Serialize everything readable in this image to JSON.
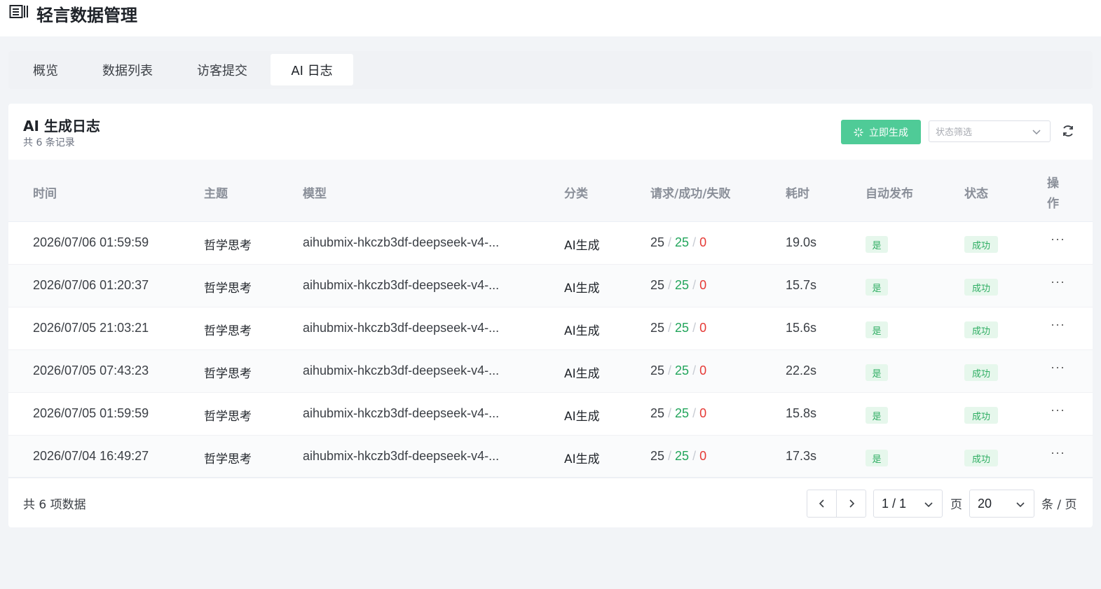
{
  "header": {
    "title": "轻言数据管理",
    "icon": "book-menu-icon"
  },
  "tabs": [
    {
      "label": "概览",
      "active": false
    },
    {
      "label": "数据列表",
      "active": false
    },
    {
      "label": "访客提交",
      "active": false
    },
    {
      "label": "AI 日志",
      "active": true
    }
  ],
  "card": {
    "title": "AI 生成日志",
    "subtitle": "共 6 条记录",
    "generate_button": "立即生成",
    "status_filter_placeholder": "状态筛选",
    "refresh_icon": "refresh-icon"
  },
  "table": {
    "columns": [
      "时间",
      "主题",
      "模型",
      "分类",
      "请求/成功/失败",
      "耗时",
      "自动发布",
      "状态",
      "操作"
    ],
    "rows": [
      {
        "time": "2026/07/06 01:59:59",
        "topic": "哲学思考",
        "model": "aihubmix-hkczb3df-deepseek-v4-...",
        "category": "AI生成",
        "req": "25",
        "success": "25",
        "fail": "0",
        "duration": "19.0s",
        "auto_publish": "是",
        "status": "成功",
        "action": "···"
      },
      {
        "time": "2026/07/06 01:20:37",
        "topic": "哲学思考",
        "model": "aihubmix-hkczb3df-deepseek-v4-...",
        "category": "AI生成",
        "req": "25",
        "success": "25",
        "fail": "0",
        "duration": "15.7s",
        "auto_publish": "是",
        "status": "成功",
        "action": "···"
      },
      {
        "time": "2026/07/05 21:03:21",
        "topic": "哲学思考",
        "model": "aihubmix-hkczb3df-deepseek-v4-...",
        "category": "AI生成",
        "req": "25",
        "success": "25",
        "fail": "0",
        "duration": "15.6s",
        "auto_publish": "是",
        "status": "成功",
        "action": "···"
      },
      {
        "time": "2026/07/05 07:43:23",
        "topic": "哲学思考",
        "model": "aihubmix-hkczb3df-deepseek-v4-...",
        "category": "AI生成",
        "req": "25",
        "success": "25",
        "fail": "0",
        "duration": "22.2s",
        "auto_publish": "是",
        "status": "成功",
        "action": "···"
      },
      {
        "time": "2026/07/05 01:59:59",
        "topic": "哲学思考",
        "model": "aihubmix-hkczb3df-deepseek-v4-...",
        "category": "AI生成",
        "req": "25",
        "success": "25",
        "fail": "0",
        "duration": "15.8s",
        "auto_publish": "是",
        "status": "成功",
        "action": "···"
      },
      {
        "time": "2026/07/04 16:49:27",
        "topic": "哲学思考",
        "model": "aihubmix-hkczb3df-deepseek-v4-...",
        "category": "AI生成",
        "req": "25",
        "success": "25",
        "fail": "0",
        "duration": "17.3s",
        "auto_publish": "是",
        "status": "成功",
        "action": "···"
      }
    ]
  },
  "pagination": {
    "total_text": "共 6 项数据",
    "page_value": "1 / 1",
    "page_label": "页",
    "page_size": "20",
    "page_size_label": "条 / 页"
  },
  "colors": {
    "accent": "#4fcb97",
    "success": "#22a55b",
    "fail": "#e53935",
    "tag_bg": "#e6f7ec"
  }
}
